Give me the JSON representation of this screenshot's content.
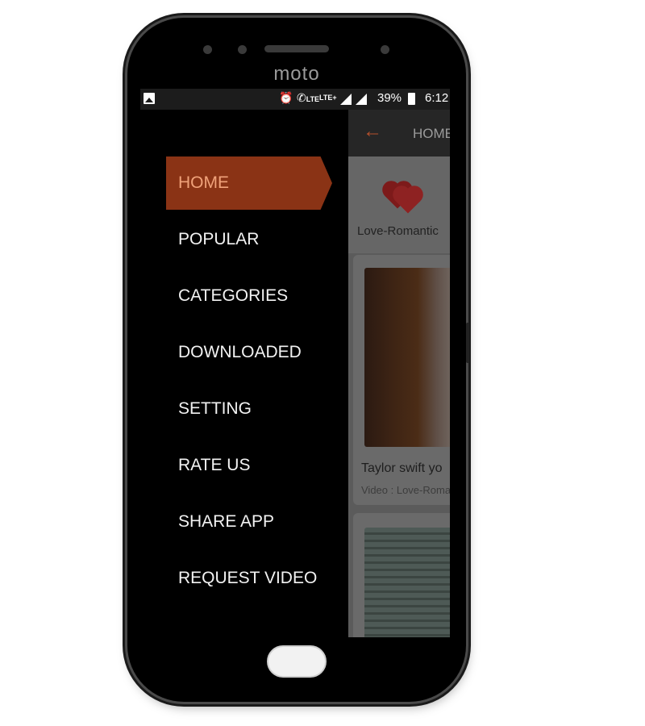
{
  "device": {
    "brand": "moto"
  },
  "status_bar": {
    "network_1": "LTE",
    "network_2": "LTE+",
    "battery": "39%",
    "time": "6:12"
  },
  "app_bar": {
    "title": "HOME"
  },
  "drawer": {
    "items": [
      {
        "label": "HOME",
        "active": true
      },
      {
        "label": "POPULAR"
      },
      {
        "label": "CATEGORIES"
      },
      {
        "label": "DOWNLOADED"
      },
      {
        "label": "SETTING"
      },
      {
        "label": "RATE US"
      },
      {
        "label": "SHARE APP"
      },
      {
        "label": "REQUEST VIDEO"
      }
    ]
  },
  "content": {
    "category": {
      "label": "Love-Romantic",
      "icon": "hearts-icon"
    },
    "videos": [
      {
        "title": "Taylor swift yo",
        "subtitle": "Video : Love-Roma"
      }
    ]
  },
  "colors": {
    "accent": "#8a3315",
    "accent_text": "#f0a27a",
    "back_arrow": "#b5502c"
  }
}
